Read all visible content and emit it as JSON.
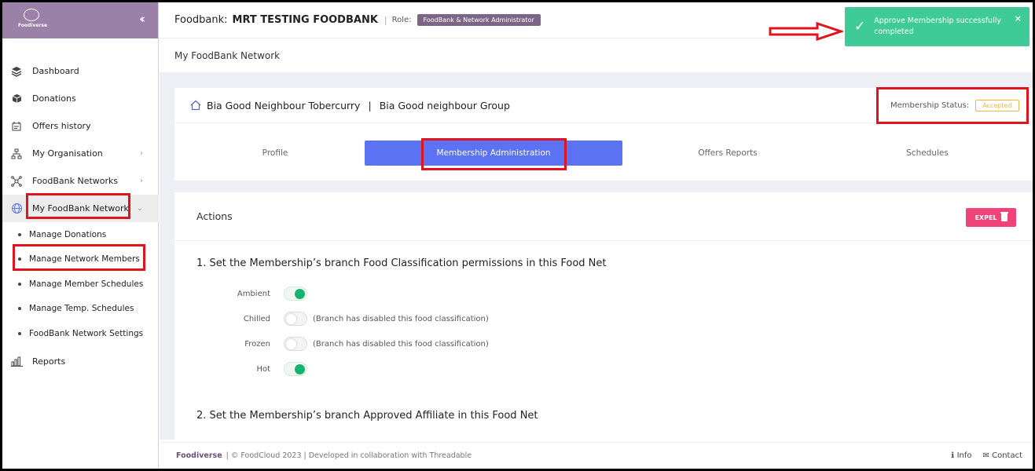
{
  "sidebar": {
    "logo_text": "Foodiverse",
    "collapse_icon": "double-chevron-left-icon",
    "items": [
      {
        "label": "Dashboard",
        "icon": "layers-icon"
      },
      {
        "label": "Donations",
        "icon": "box-icon"
      },
      {
        "label": "Offers history",
        "icon": "history-icon"
      },
      {
        "label": "My Organisation",
        "icon": "org-chart-icon"
      },
      {
        "label": "FoodBank Networks",
        "icon": "network-icon"
      },
      {
        "label": "My FoodBank Network",
        "icon": "globe-network-icon"
      },
      {
        "label": "Reports",
        "icon": "bar-chart-icon"
      }
    ],
    "subitems": [
      "Manage Donations",
      "Manage Network Members",
      "Manage Member Schedules",
      "Manage Temp. Schedules",
      "FoodBank Network Settings"
    ]
  },
  "header": {
    "foodbank_label": "Foodbank:",
    "foodbank_name": "MRT TESTING FOODBANK",
    "sep": "|",
    "role_label": "Role:",
    "role_value": "FoodBank & Network Administrator"
  },
  "subheader": {
    "title": "My FoodBank Network"
  },
  "member": {
    "branch": "Bia Good Neighbour Tobercurry",
    "pipe": "|",
    "group": "Bia Good neighbour Group",
    "status_label": "Membership Status:",
    "status_value": "Accepted",
    "tabs": [
      "Profile",
      "Membership Administration",
      "Offers Reports",
      "Schedules"
    ]
  },
  "actions": {
    "title": "Actions",
    "expel_label": "EXPEL",
    "section1_title": "1. Set the Membership’s branch Food Classification permissions in this Food Net",
    "permissions": [
      {
        "label": "Ambient",
        "enabled": true,
        "note": ""
      },
      {
        "label": "Chilled",
        "enabled": false,
        "note": "(Branch has disabled this food classification)"
      },
      {
        "label": "Frozen",
        "enabled": false,
        "note": "(Branch has disabled this food classification)"
      },
      {
        "label": "Hot",
        "enabled": true,
        "note": ""
      }
    ],
    "section2_title": "2. Set the Membership’s branch Approved Affiliate in this Food Net"
  },
  "footer": {
    "brand": "Foodiverse",
    "text": "| © FoodCloud 2023 | Developed in collaboration with Threadable",
    "info": "Info",
    "contact": "Contact"
  },
  "toast": {
    "message": "Approve Membership successfully completed",
    "close": "×"
  },
  "colors": {
    "accent": "#5b72f2",
    "brand": "#9b80a8",
    "toast": "#3fcb98",
    "danger": "#f0437a",
    "toggle_on": "#13b46b",
    "annotation": "#e0141c"
  }
}
